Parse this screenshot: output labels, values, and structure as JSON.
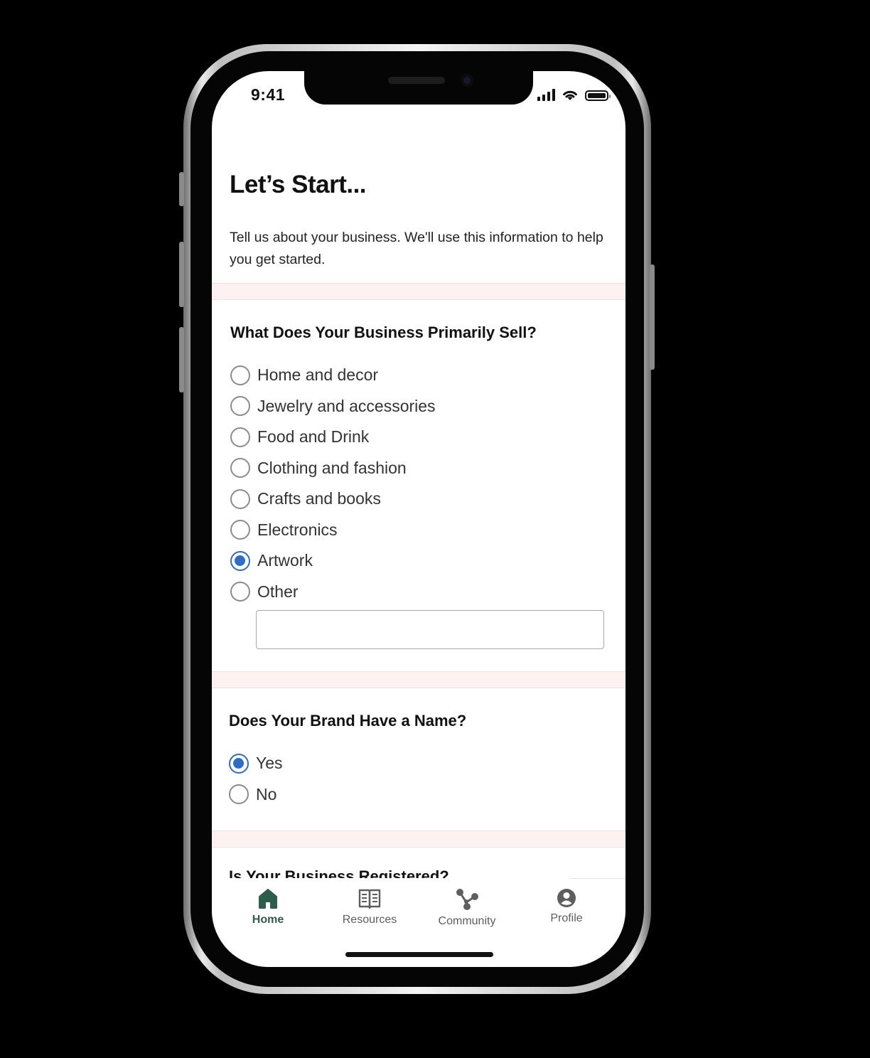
{
  "status_bar": {
    "time": "9:41"
  },
  "header": {
    "title": "Let’s Start...",
    "intro": "Tell us about your business. We'll use this information to help you get started."
  },
  "questions": [
    {
      "title": "What Does Your Business Primarily Sell?",
      "options": [
        {
          "label": "Home and decor",
          "selected": false
        },
        {
          "label": "Jewelry and accessories",
          "selected": false
        },
        {
          "label": "Food and Drink",
          "selected": false
        },
        {
          "label": "Clothing and fashion",
          "selected": false
        },
        {
          "label": "Crafts and books",
          "selected": false
        },
        {
          "label": "Electronics",
          "selected": false
        },
        {
          "label": "Artwork",
          "selected": true
        },
        {
          "label": "Other",
          "selected": false
        }
      ],
      "other_input": {
        "value": "",
        "placeholder": ""
      }
    },
    {
      "title": "Does Your Brand Have a Name?",
      "options": [
        {
          "label": "Yes",
          "selected": true
        },
        {
          "label": "No",
          "selected": false
        }
      ]
    },
    {
      "title": "Is Your Business Registered?"
    }
  ],
  "tab_bar": {
    "active": "Home",
    "items": [
      {
        "label": "Home",
        "icon": "home-icon"
      },
      {
        "label": "Resources",
        "icon": "book-icon"
      },
      {
        "label": "Community",
        "icon": "network-icon"
      },
      {
        "label": "Profile",
        "icon": "profile-icon"
      }
    ]
  },
  "colors": {
    "accent_radio": "#2f6cc6",
    "tab_active": "#2e5d4c",
    "tab_inactive": "#5e5e5e",
    "section_band": "#fdf2f1"
  }
}
